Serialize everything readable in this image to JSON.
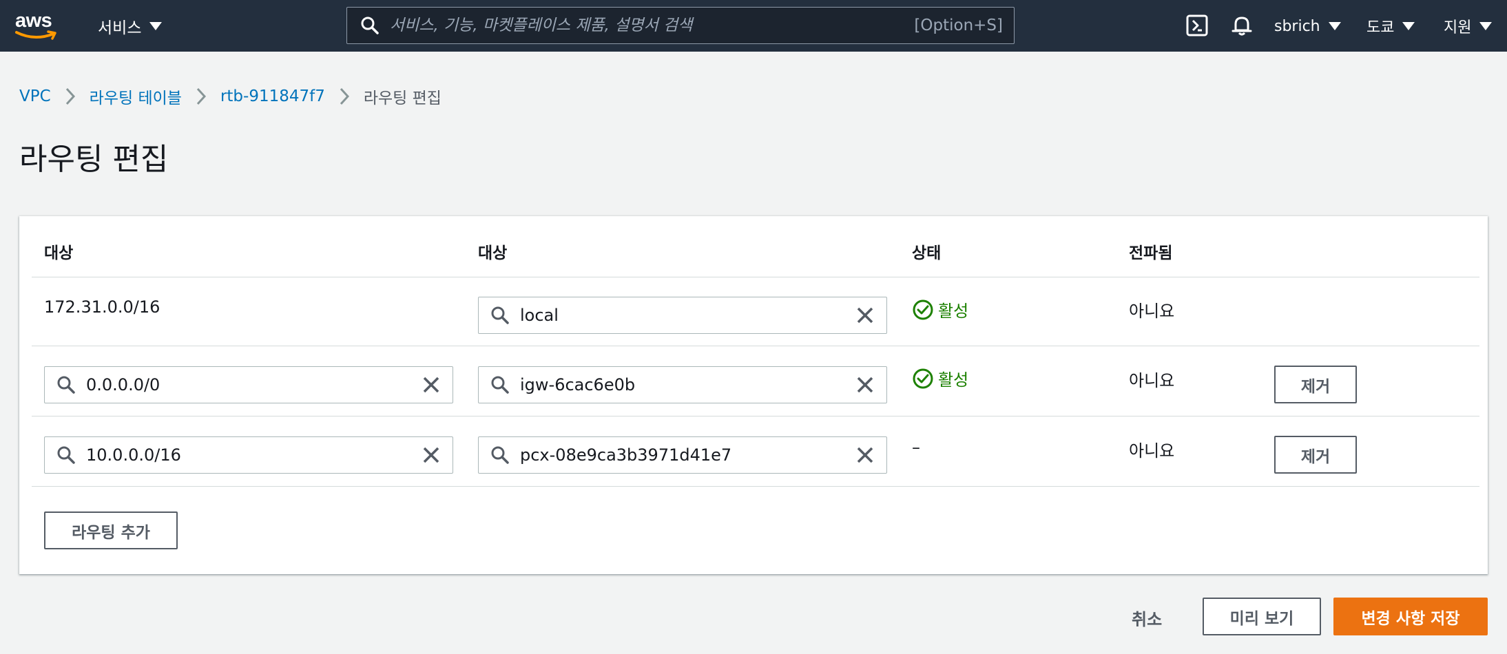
{
  "topnav": {
    "logo_text": "aws",
    "services_label": "서비스",
    "search_placeholder": "서비스, 기능, 마켓플레이스 제품, 설명서 검색",
    "search_shortcut": "[Option+S]",
    "user_label": "sbrich",
    "region_label": "도쿄",
    "support_label": "지원"
  },
  "breadcrumb": {
    "items": [
      "VPC",
      "라우팅 테이블",
      "rtb-911847f7"
    ],
    "current": "라우팅 편집"
  },
  "page": {
    "title": "라우팅 편집"
  },
  "table": {
    "headers": [
      "대상",
      "대상",
      "상태",
      "전파됨"
    ],
    "rows": [
      {
        "destination": "172.31.0.0/16",
        "target": "local",
        "status": "활성",
        "propagated": "아니요"
      },
      {
        "destination": "0.0.0.0/0",
        "target": "igw-6cac6e0b",
        "status": "활성",
        "propagated": "아니요",
        "remove_label": "제거"
      },
      {
        "destination": "10.0.0.0/16",
        "target": "pcx-08e9ca3b3971d41e7",
        "status": "–",
        "propagated": "아니요",
        "remove_label": "제거"
      }
    ],
    "add_route_label": "라우팅 추가"
  },
  "footer": {
    "cancel_label": "취소",
    "preview_label": "미리 보기",
    "save_label": "변경 사항 저장"
  },
  "colors": {
    "nav_bg": "#232f3e",
    "link": "#0073bb",
    "status_success": "#1d8102",
    "primary": "#ec7211"
  }
}
